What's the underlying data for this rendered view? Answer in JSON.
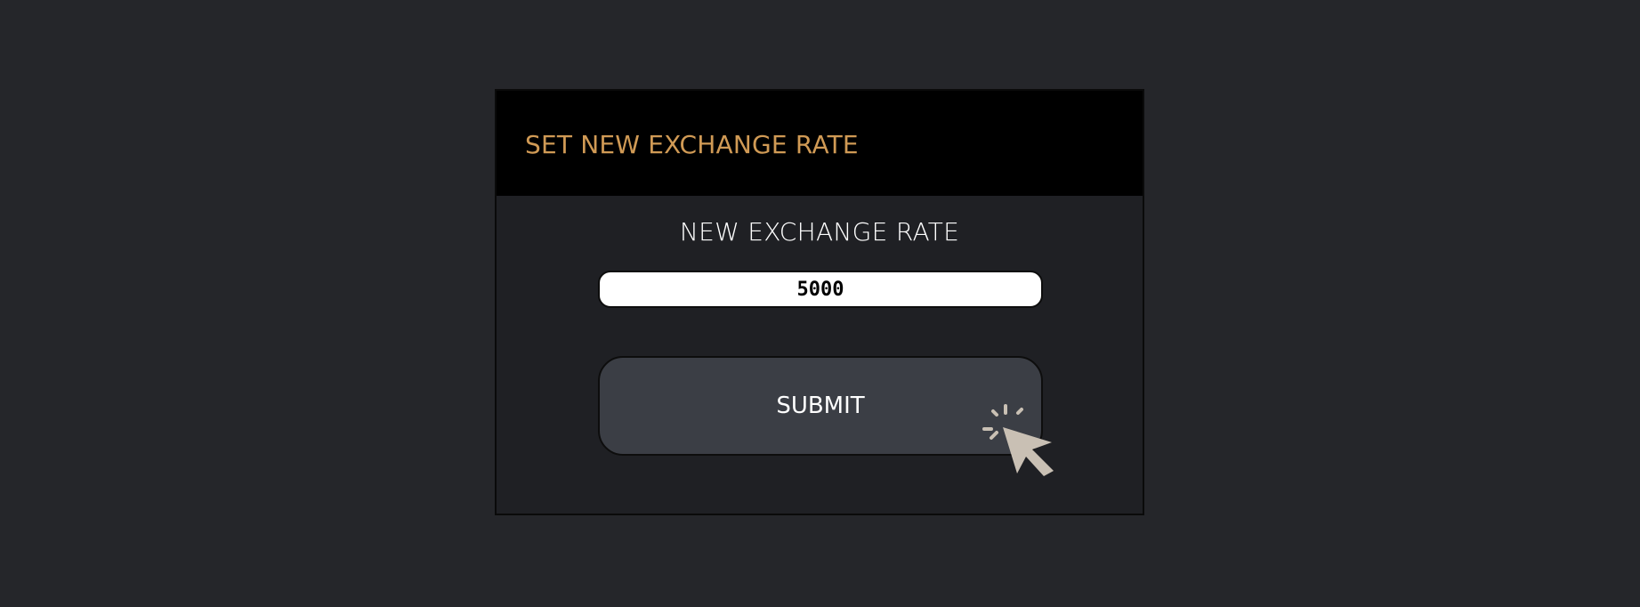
{
  "dialog": {
    "title": "SET NEW EXCHANGE RATE",
    "field_label": "NEW EXCHANGE RATE",
    "input_value": "5000",
    "submit_label": "SUBMIT"
  },
  "colors": {
    "title": "#d09a55",
    "cursor": "#c9c0b4"
  },
  "icons": {
    "cursor": "click-cursor-icon"
  }
}
